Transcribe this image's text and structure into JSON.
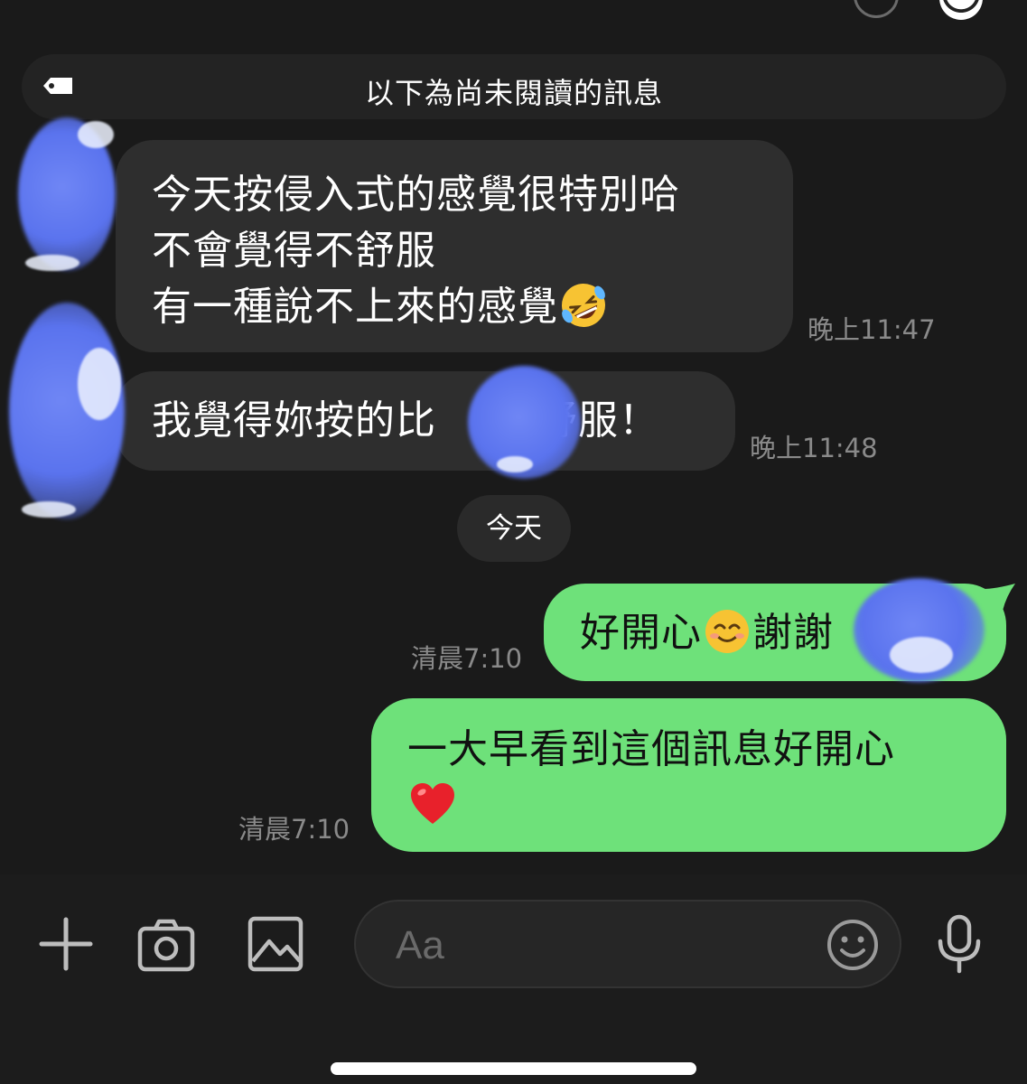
{
  "unread_banner": {
    "text": "以下為尚未閱讀的訊息",
    "icon": "tag-icon"
  },
  "messages": [
    {
      "direction": "incoming",
      "lines": [
        "今天按侵入式的感覺很特別哈",
        "不會覺得不舒服",
        "有一種說不上來的感覺"
      ],
      "trailing_emoji": "rolling-on-floor-laughing-emoji",
      "time": "晚上11:47"
    },
    {
      "direction": "incoming",
      "before_blur": "我覺得妳按的比",
      "after_blur": "舒服！",
      "time": "晚上11:48"
    },
    {
      "direction": "outgoing",
      "before_emoji": "好開心",
      "emoji": "smiling-face-emoji",
      "after_emoji": "謝謝",
      "time": "清晨7:10"
    },
    {
      "direction": "outgoing",
      "lines": [
        "一大早看到這個訊息好開心"
      ],
      "trailing_emoji": "red-heart-emoji",
      "time": "清晨7:10"
    }
  ],
  "date_separator": "今天",
  "input_bar": {
    "placeholder": "Aa",
    "icons": [
      "plus-icon",
      "camera-icon",
      "image-icon",
      "emoji-icon",
      "microphone-icon"
    ]
  },
  "colors": {
    "background": "#1a1a1a",
    "incoming_bubble": "#2e2e2e",
    "outgoing_bubble": "#6ee17a",
    "time_text": "#8a8a8a"
  }
}
